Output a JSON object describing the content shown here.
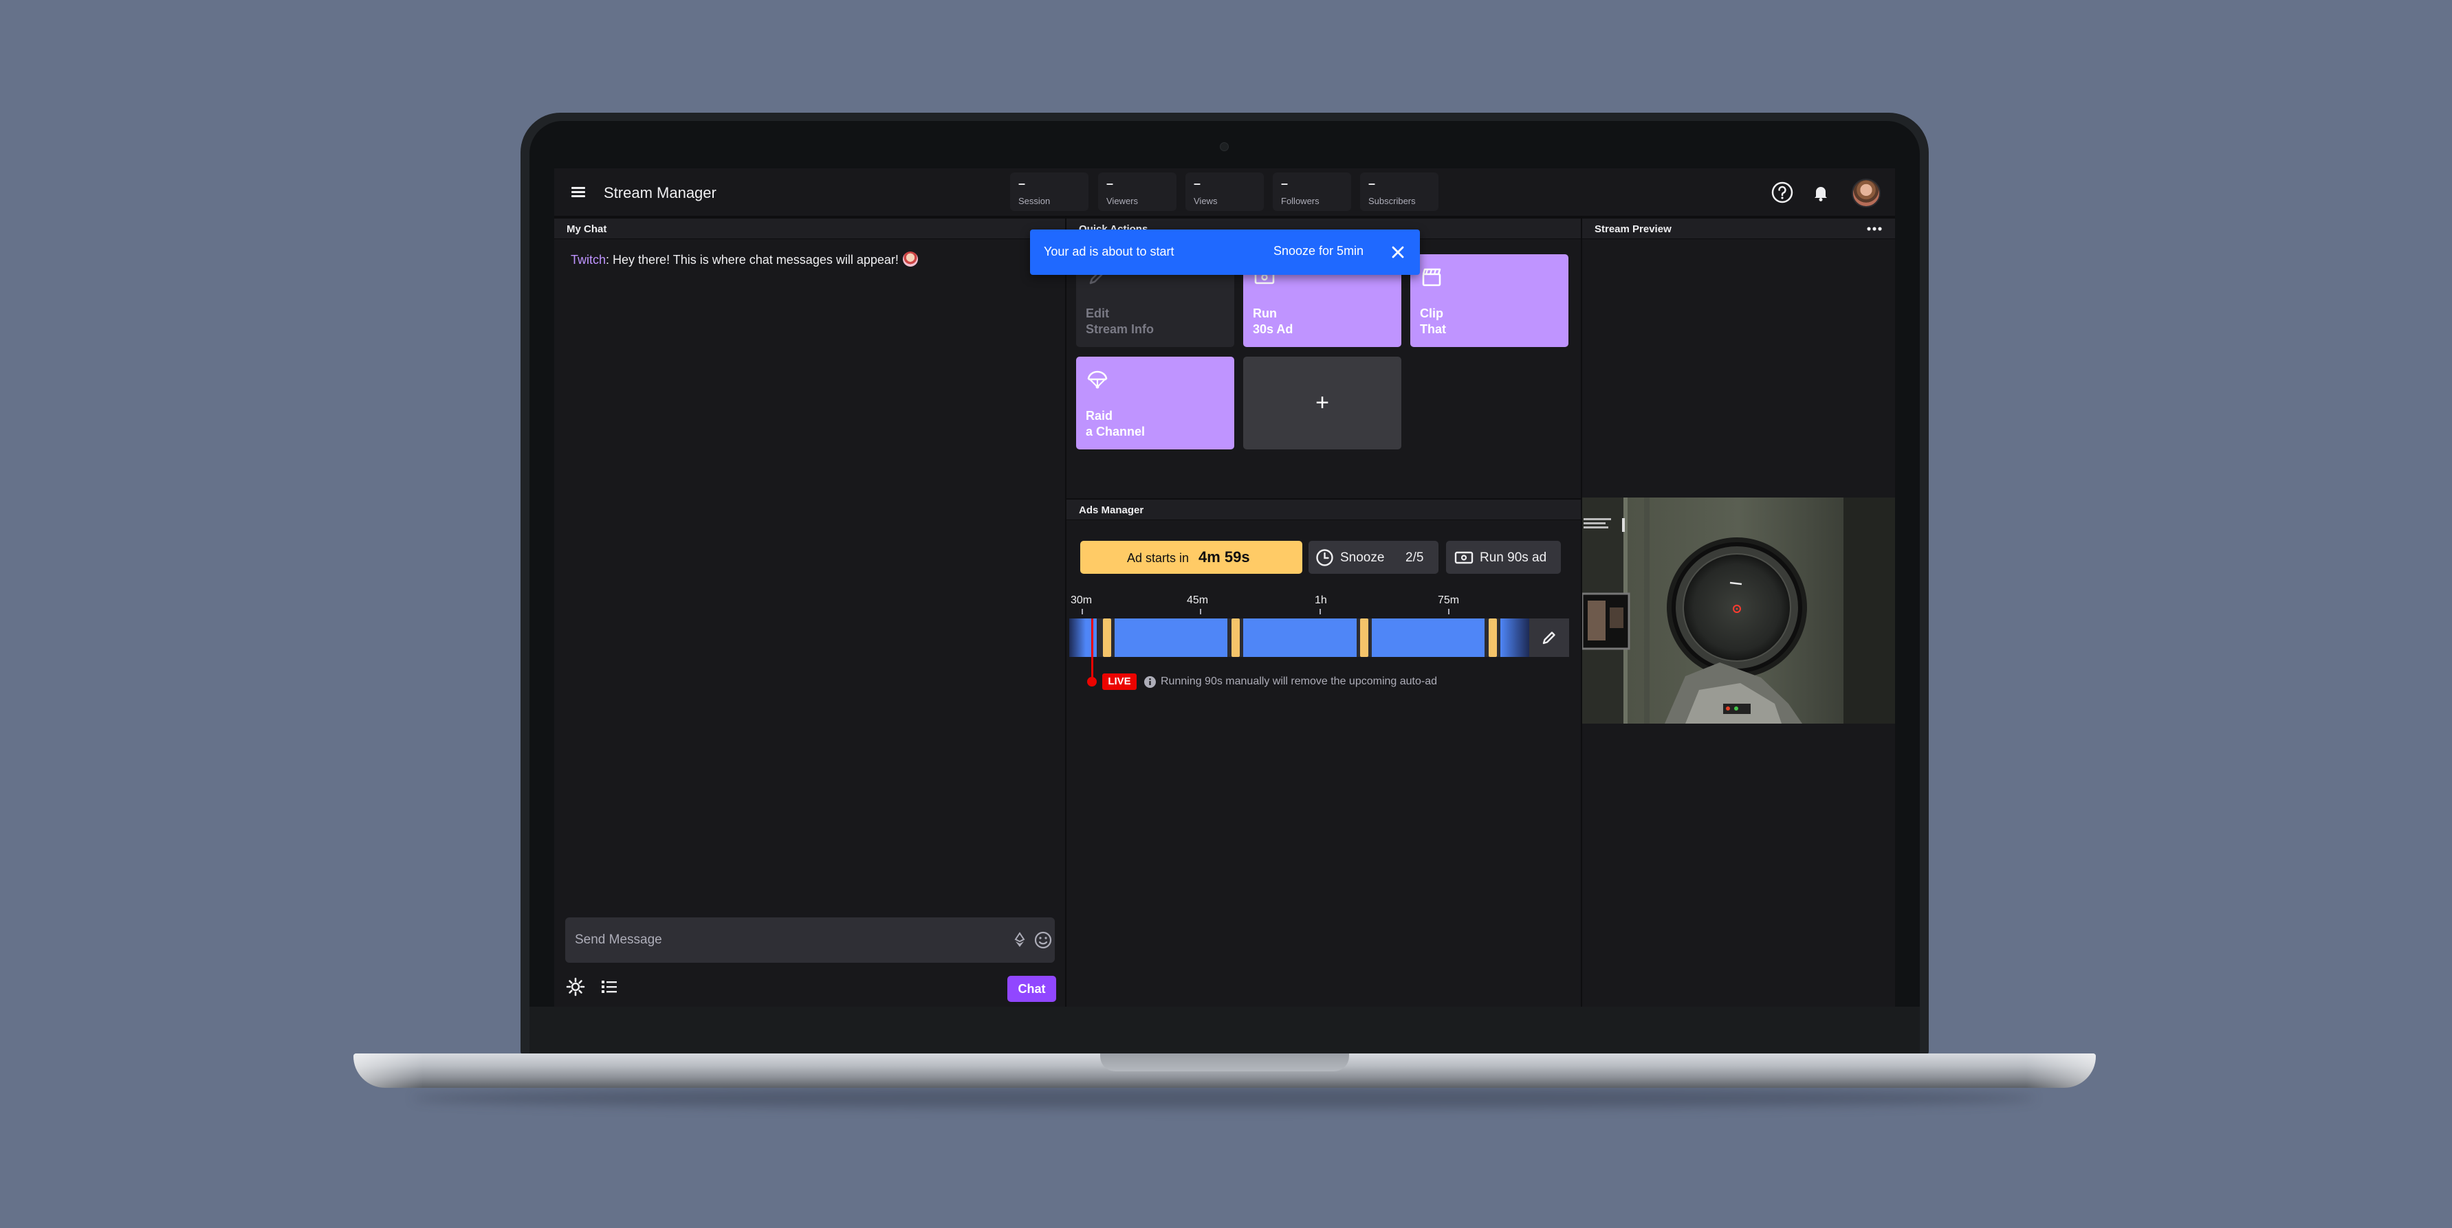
{
  "app": {
    "title": "Stream Manager"
  },
  "stats": [
    {
      "value": "–",
      "label": "Session"
    },
    {
      "value": "–",
      "label": "Viewers"
    },
    {
      "value": "–",
      "label": "Views"
    },
    {
      "value": "–",
      "label": "Followers"
    },
    {
      "value": "–",
      "label": "Subscribers"
    }
  ],
  "chat": {
    "title": "My Chat",
    "messages": [
      {
        "user": "Twitch",
        "separator": ": ",
        "text": "Hey there! This is where chat messages will appear!"
      }
    ],
    "input_placeholder": "Send Message",
    "send_label": "Chat"
  },
  "quick_actions": {
    "title": "Quick Actions",
    "tiles": [
      {
        "line1": "Edit",
        "line2": "Stream Info",
        "icon": "pencil-icon",
        "enabled": false
      },
      {
        "line1": "Run",
        "line2": "30s Ad",
        "icon": "ad-icon",
        "enabled": true
      },
      {
        "line1": "Clip",
        "line2": "That",
        "icon": "clapper-icon",
        "enabled": true
      },
      {
        "line1": "Raid",
        "line2": "a Channel",
        "icon": "parachute-icon",
        "enabled": true
      }
    ],
    "add_label": "+"
  },
  "toast": {
    "message": "Your ad is about to start",
    "action": "Snooze for 5min"
  },
  "ads_manager": {
    "title": "Ads Manager",
    "ad_starts_label": "Ad starts in",
    "ad_starts_time": "4m 59s",
    "snooze_label": "Snooze",
    "snooze_count": "2/5",
    "run_label": "Run 90s ad",
    "timeline_labels": [
      "30m",
      "45m",
      "1h",
      "75m"
    ],
    "live_label": "LIVE",
    "info_text": "Running 90s manually will remove the upcoming auto-ad"
  },
  "preview": {
    "title": "Stream Preview"
  },
  "colors": {
    "accent_purple": "#9147ff",
    "tile_purple": "#bf94ff",
    "toast_blue": "#1f69ff",
    "ad_yellow": "#ffcb66",
    "live_red": "#eb0400",
    "timeline_blue": "#4f86f7"
  }
}
